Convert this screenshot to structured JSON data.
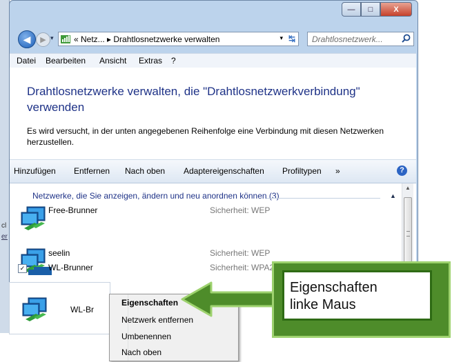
{
  "background_window": {
    "fragment1": "cl",
    "fragment2": "er"
  },
  "nav": {
    "address_path": "« Netz... ▸ Drahtlosnetzwerke verwalten",
    "search_placeholder": "Drahtlosnetzwerk...",
    "back_glyph": "◀",
    "forward_glyph": "▶",
    "dropdown_glyph": "▾",
    "refresh_glyph": "↹"
  },
  "window_buttons": {
    "minimize": "—",
    "maximize": "□",
    "close": "X"
  },
  "menu": [
    "Datei",
    "Bearbeiten",
    "Ansicht",
    "Extras",
    "?"
  ],
  "page": {
    "title": "Drahtlosnetzwerke verwalten, die \"Drahtlosnetzwerkverbindung\" verwenden",
    "description": "Es wird versucht, in der unten angegebenen Reihenfolge eine Verbindung mit diesen Netzwerken herzustellen."
  },
  "toolbar": {
    "items": [
      "Hinzufügen",
      "Entfernen",
      "Nach oben",
      "Adaptereigenschaften",
      "Profiltypen",
      "»"
    ],
    "help": "?"
  },
  "group": {
    "header": "Netzwerke, die Sie anzeigen, ändern und neu anordnen können (3)",
    "collapse_glyph": "▲"
  },
  "networks": [
    {
      "name": "Free-Brunner",
      "security": "Sicherheit: WEP"
    },
    {
      "name": "seelin",
      "security": "Sicherheit: WEP"
    },
    {
      "name": "WL-Brunner",
      "security": "Sicherheit: WPA2"
    }
  ],
  "drag_ghost": {
    "label": "WL-Br"
  },
  "context_menu": [
    "Eigenschaften",
    "Netzwerk entfernen",
    "Umbenennen",
    "Nach oben"
  ],
  "annotation": {
    "line1": "Eigenschaften",
    "line2": "linke Maus"
  },
  "scrollbar": {
    "up_glyph": "▲"
  },
  "colors": {
    "annotation_green": "#4e8c2a",
    "link_blue": "#1e3287"
  }
}
